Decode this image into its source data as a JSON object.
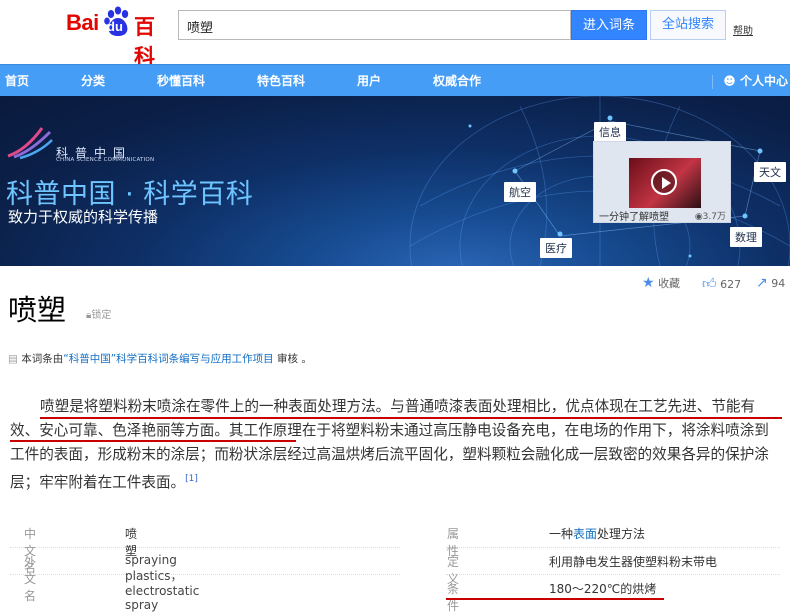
{
  "header": {
    "logo_text_bai": "Bai",
    "logo_text_du": "du",
    "logo_text_baike": "百科",
    "search_value": "喷塑",
    "enter_button": "进入词条",
    "site_search_button": "全站搜索",
    "help_link": "帮助"
  },
  "nav": {
    "items": [
      "首页",
      "分类",
      "秒懂百科",
      "特色百科",
      "用户",
      "权威合作"
    ],
    "user_center": "个人中心"
  },
  "banner": {
    "org_cn": "科普中国",
    "org_en": "CHINA SCIENCE COMMUNICATION",
    "title": "科普中国 · 科学百科",
    "subtitle": "致力于权威的科学传播",
    "tags": [
      "信息",
      "天文",
      "航空",
      "医疗",
      "数理"
    ],
    "video_title": "一分钟了解喷塑",
    "video_views": "3.7万"
  },
  "actions": {
    "collect": "收藏",
    "likes": "627",
    "shares": "94"
  },
  "lemma": {
    "title": "喷塑",
    "lock_label": "锁定",
    "review_prefix": "本词条由",
    "review_link": "“科普中国”科学百科词条编写与应用工作项目",
    "review_suffix": " 审核 。"
  },
  "summary": {
    "text": "喷塑是将塑料粉末喷涂在零件上的一种表面处理方法。与普通喷漆表面处理相比，优点体现在工艺先进、节能有效、安心可靠、色泽艳丽等方面。其工作原理在于将塑料粉末通过高压静电设备充电，在电场的作用下，将涂料喷涂到工件的表面，形成粉末的涂层；而粉状涂层经过高温烘烤后流平固化，塑料颗粒会融化成一层致密的效果各异的保护涂层；牢牢附着在工件表面。",
    "ref": "[1]"
  },
  "info": {
    "left": [
      {
        "key": "中文名",
        "value": "喷塑"
      },
      {
        "key": "外文名",
        "value": "spraying plastics，electrostatic spray"
      }
    ],
    "right": [
      {
        "key": "属　性",
        "value_pre": "一种",
        "value_link": "表面",
        "value_post": "处理方法"
      },
      {
        "key": "定　义",
        "value": "利用静电发生器使塑料粉末带电"
      },
      {
        "key": "条　件",
        "value": "180～220℃的烘烤"
      }
    ]
  }
}
